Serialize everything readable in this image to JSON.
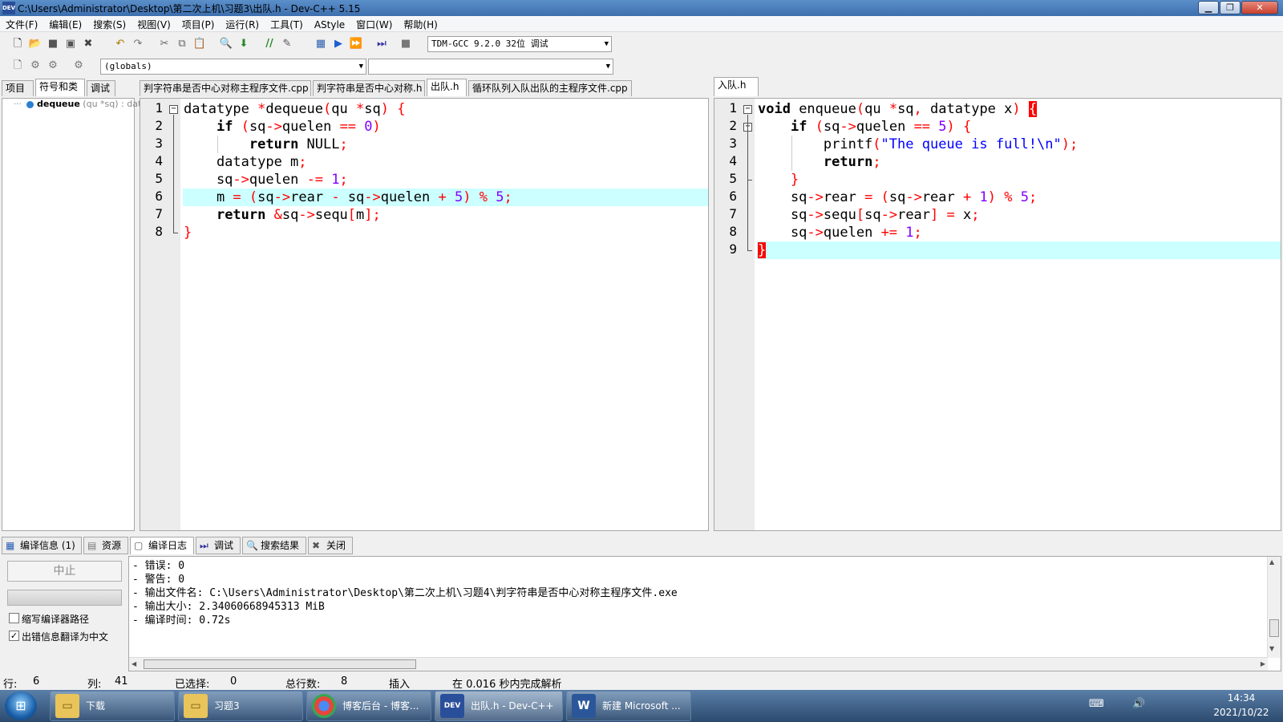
{
  "window": {
    "title": "C:\\Users\\Administrator\\Desktop\\第二次上机\\习题3\\出队.h - Dev-C++ 5.15"
  },
  "menu": [
    "文件(F)",
    "编辑(E)",
    "搜索(S)",
    "视图(V)",
    "项目(P)",
    "运行(R)",
    "工具(T)",
    "AStyle",
    "窗口(W)",
    "帮助(H)"
  ],
  "toolbar": {
    "compiler": "TDM-GCC 9.2.0 32位 调试",
    "scope": "(globals)",
    "function": ""
  },
  "left_panel": {
    "tabs": [
      "项目",
      "符号和类",
      "调试"
    ],
    "active_tab": 1,
    "tree_item_name": "dequeue",
    "tree_item_sig": "(qu *sq) : data"
  },
  "editor_left": {
    "tabs": [
      "判字符串是否中心对称主程序文件.cpp",
      "判字符串是否中心对称.h",
      "出队.h",
      "循环队列入队出队的主程序文件.cpp"
    ],
    "active_tab": 2,
    "line_numbers": [
      "1",
      "2",
      "3",
      "4",
      "5",
      "6",
      "7",
      "8"
    ],
    "highlight_line": 6
  },
  "editor_right": {
    "tabs": [
      "入队.h"
    ],
    "line_numbers": [
      "1",
      "2",
      "3",
      "4",
      "5",
      "6",
      "7",
      "8",
      "9"
    ],
    "highlight_line": 9
  },
  "bottom": {
    "tabs": [
      "编译信息 (1)",
      "资源",
      "编译日志",
      "调试",
      "搜索结果",
      "关闭"
    ],
    "active_tab": 2,
    "stop_button": "中止",
    "options": [
      {
        "label": "缩写编译器路径",
        "checked": false
      },
      {
        "label": "出错信息翻译为中文",
        "checked": true
      }
    ],
    "log": [
      "- 错误: 0",
      "- 警告: 0",
      "- 输出文件名: C:\\Users\\Administrator\\Desktop\\第二次上机\\习题4\\判字符串是否中心对称主程序文件.exe",
      "- 输出大小: 2.34060668945313 MiB",
      "- 编译时间: 0.72s"
    ]
  },
  "status": {
    "line_label": "行:",
    "line": "6",
    "col_label": "列:",
    "col": "41",
    "sel_label": "已选择:",
    "sel": "0",
    "total_label": "总行数:",
    "total": "8",
    "mode": "插入",
    "parse": "在 0.016 秒内完成解析"
  },
  "taskbar": {
    "items": [
      "下载",
      "习题3",
      "博客后台 - 博客...",
      "出队.h - Dev-C++",
      "新建 Microsoft ..."
    ],
    "time": "14:34",
    "date": "2021/10/22"
  },
  "colors": {
    "highlight": "#ccffff",
    "keyword_op": "#ff0000",
    "number": "#8000ff",
    "string": "#0000ff"
  }
}
